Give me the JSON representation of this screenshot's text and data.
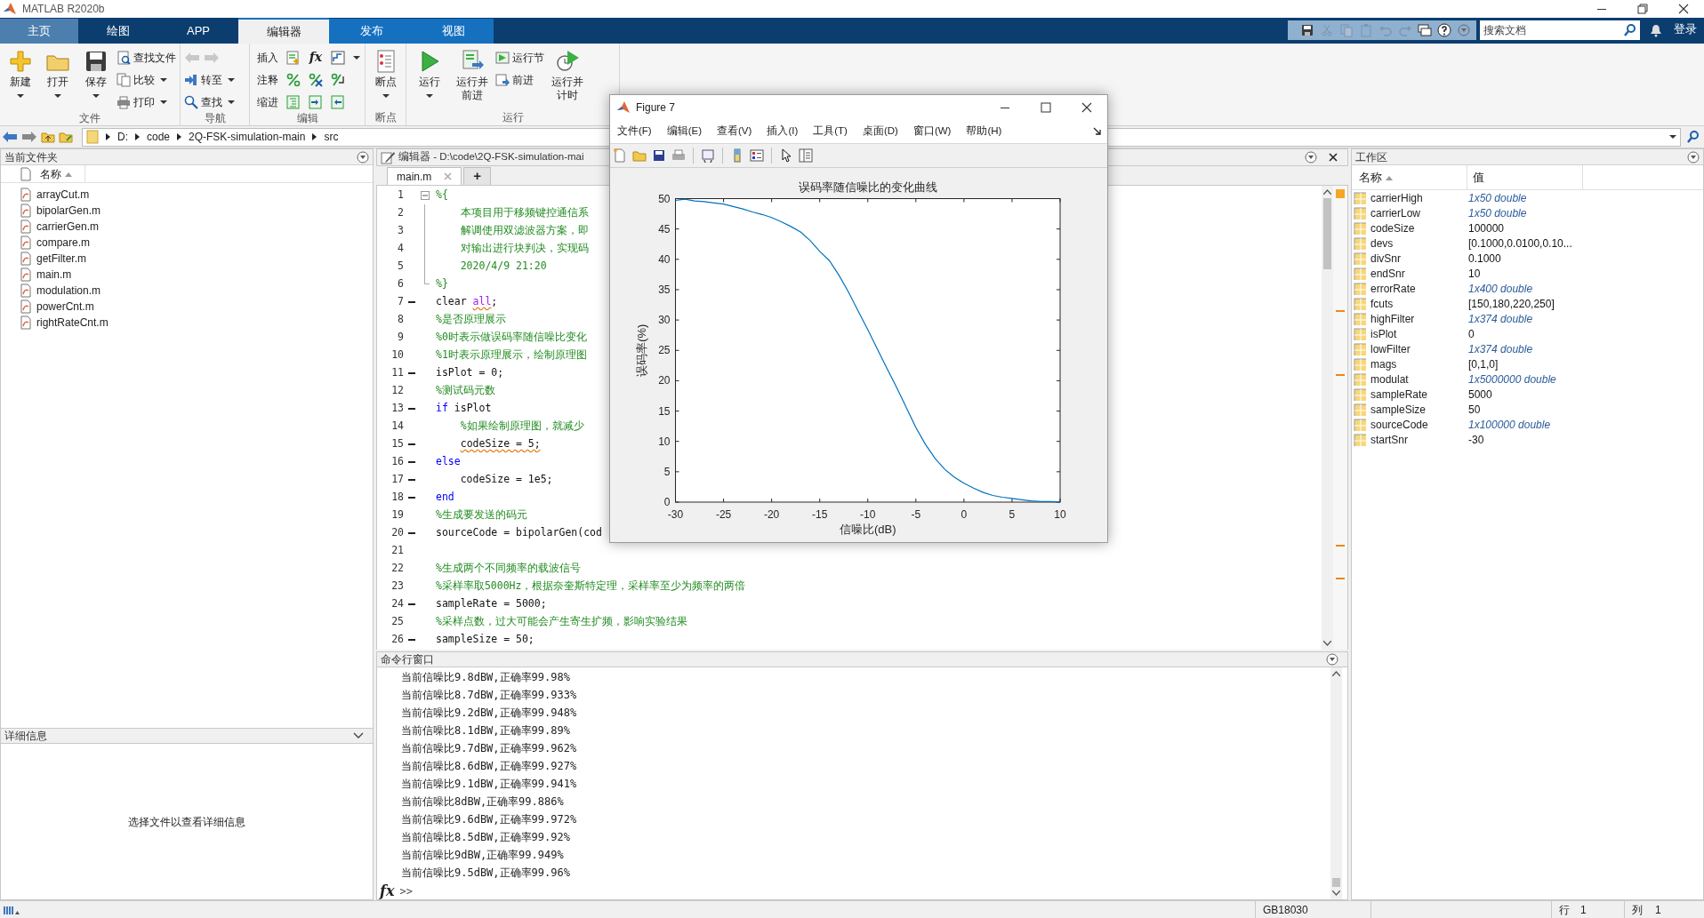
{
  "window": {
    "title": "MATLAB R2020b"
  },
  "ribbon_tabs": [
    {
      "label": "主页",
      "selected": false,
      "highlighted": true,
      "contextual": false
    },
    {
      "label": "绘图",
      "selected": false,
      "highlighted": false,
      "contextual": false
    },
    {
      "label": "APP",
      "selected": false,
      "highlighted": false,
      "contextual": false
    },
    {
      "label": "编辑器",
      "selected": true,
      "highlighted": false,
      "contextual": true
    },
    {
      "label": "发布",
      "selected": false,
      "highlighted": false,
      "contextual": true
    },
    {
      "label": "视图",
      "selected": false,
      "highlighted": false,
      "contextual": true
    }
  ],
  "search": {
    "placeholder": "搜索文档"
  },
  "sign_in": "登录",
  "ribbon_groups": [
    {
      "label": "文件",
      "items": [
        {
          "kind": "large",
          "label": "新建",
          "dropdown": true
        },
        {
          "kind": "large",
          "label": "打开",
          "dropdown": true
        },
        {
          "kind": "large",
          "label": "保存",
          "dropdown": true
        },
        {
          "kind": "small",
          "label": "查找文件",
          "dropdown": false
        },
        {
          "kind": "small",
          "label": "比较",
          "dropdown": true
        },
        {
          "kind": "small",
          "label": "打印",
          "dropdown": true
        }
      ]
    },
    {
      "label": "导航",
      "items": [
        {
          "kind": "history",
          "disabled": true
        },
        {
          "kind": "small",
          "label": "转至",
          "dropdown": true
        },
        {
          "kind": "small",
          "label": "查找",
          "dropdown": true
        }
      ]
    },
    {
      "label": "编辑",
      "items": [
        {
          "kind": "row",
          "label": "插入",
          "glyph": "fx",
          "dropdown": true
        },
        {
          "kind": "row",
          "label": "注释",
          "dropdown": false
        },
        {
          "kind": "row",
          "label": "缩进",
          "dropdown": false
        }
      ]
    },
    {
      "label": "断点",
      "items": [
        {
          "kind": "large",
          "label": "断点",
          "dropdown": true
        }
      ]
    },
    {
      "label": "运行",
      "items": [
        {
          "kind": "large",
          "label": "运行",
          "dropdown": true
        },
        {
          "kind": "large",
          "label": "运行并前进",
          "dropdown": false
        },
        {
          "kind": "small",
          "label": "运行节",
          "dropdown": false
        },
        {
          "kind": "small",
          "label": "前进",
          "dropdown": false
        },
        {
          "kind": "large",
          "label": "运行并计时",
          "dropdown": false
        }
      ]
    }
  ],
  "address_bar": {
    "path": [
      "D:",
      "code",
      "2Q-FSK-simulation-main",
      "src"
    ]
  },
  "current_folder": {
    "title": "当前文件夹",
    "column": "名称",
    "files": [
      "arrayCut.m",
      "bipolarGen.m",
      "carrierGen.m",
      "compare.m",
      "getFilter.m",
      "main.m",
      "modulation.m",
      "powerCnt.m",
      "rightRateCnt.m"
    ]
  },
  "details": {
    "title": "详细信息",
    "message": "选择文件以查看详细信息"
  },
  "editor": {
    "title": "编辑器 - D:\\code\\2Q-FSK-simulation-mai",
    "tabs": [
      {
        "label": "main.m",
        "selected": true
      },
      {
        "label": "+",
        "selected": false
      }
    ],
    "lines": [
      {
        "number": "1",
        "executable": false,
        "fold_start": true,
        "segments": [
          {
            "text": "%{",
            "kind": "comment"
          }
        ]
      },
      {
        "number": "2",
        "executable": false,
        "segments": [
          {
            "text": "    本项目用于移频键控通信系",
            "kind": "comment"
          }
        ]
      },
      {
        "number": "3",
        "executable": false,
        "segments": [
          {
            "text": "    解调使用双滤波器方案，即",
            "kind": "comment"
          }
        ]
      },
      {
        "number": "4",
        "executable": false,
        "segments": [
          {
            "text": "    对输出进行块判决，实现码",
            "kind": "comment"
          }
        ]
      },
      {
        "number": "5",
        "executable": false,
        "segments": [
          {
            "text": "    2020/4/9 21:20",
            "kind": "comment"
          }
        ]
      },
      {
        "number": "6",
        "executable": false,
        "fold_end": true,
        "segments": [
          {
            "text": "%}",
            "kind": "comment"
          }
        ]
      },
      {
        "number": "7",
        "executable": true,
        "segments": [
          {
            "text": "clear ",
            "kind": "code"
          },
          {
            "text": "all",
            "kind": "string",
            "warning": true
          },
          {
            "text": ";",
            "kind": "code"
          }
        ]
      },
      {
        "number": "8",
        "executable": false,
        "segments": [
          {
            "text": "%是否原理展示",
            "kind": "comment"
          }
        ]
      },
      {
        "number": "9",
        "executable": false,
        "segments": [
          {
            "text": "%0时表示做误码率随信噪比变化",
            "kind": "comment"
          }
        ]
      },
      {
        "number": "10",
        "executable": false,
        "segments": [
          {
            "text": "%1时表示原理展示，绘制原理图",
            "kind": "comment"
          }
        ]
      },
      {
        "number": "11",
        "executable": true,
        "segments": [
          {
            "text": "isPlot = 0;",
            "kind": "code"
          }
        ]
      },
      {
        "number": "12",
        "executable": false,
        "segments": [
          {
            "text": "%测试码元数",
            "kind": "comment"
          }
        ]
      },
      {
        "number": "13",
        "executable": true,
        "segments": [
          {
            "text": "if",
            "kind": "keyword"
          },
          {
            "text": " isPlot",
            "kind": "code"
          }
        ]
      },
      {
        "number": "14",
        "executable": false,
        "segments": [
          {
            "text": "    %如果绘制原理图，就减少",
            "kind": "comment"
          }
        ]
      },
      {
        "number": "15",
        "executable": true,
        "segments": [
          {
            "text": "    codeSize = 5;",
            "kind": "code",
            "warning": true
          }
        ]
      },
      {
        "number": "16",
        "executable": true,
        "segments": [
          {
            "text": "else",
            "kind": "keyword"
          }
        ]
      },
      {
        "number": "17",
        "executable": true,
        "segments": [
          {
            "text": "    codeSize = 1e5;",
            "kind": "code"
          }
        ]
      },
      {
        "number": "18",
        "executable": true,
        "segments": [
          {
            "text": "end",
            "kind": "keyword"
          }
        ]
      },
      {
        "number": "19",
        "executable": false,
        "segments": [
          {
            "text": "%生成要发送的码元",
            "kind": "comment"
          }
        ]
      },
      {
        "number": "20",
        "executable": true,
        "segments": [
          {
            "text": "sourceCode = bipolarGen(cod",
            "kind": "code"
          }
        ]
      },
      {
        "number": "21",
        "executable": false
      },
      {
        "number": "22",
        "executable": false,
        "segments": [
          {
            "text": "%生成两个不同频率的载波信号",
            "kind": "comment"
          }
        ]
      },
      {
        "number": "23",
        "executable": false,
        "segments": [
          {
            "text": "%采样率取5000Hz，根据奈奎斯特定理，采样率至少为频率的两倍",
            "kind": "comment"
          }
        ]
      },
      {
        "number": "24",
        "executable": true,
        "segments": [
          {
            "text": "sampleRate = 5000;",
            "kind": "code"
          }
        ]
      },
      {
        "number": "25",
        "executable": false,
        "segments": [
          {
            "text": "%采样点数，过大可能会产生寄生扩频，影响实验结果",
            "kind": "comment"
          }
        ]
      },
      {
        "number": "26",
        "executable": true,
        "segments": [
          {
            "text": "sampleSize = 50;",
            "kind": "code"
          }
        ]
      }
    ]
  },
  "command_window": {
    "title": "命令行窗口",
    "lines": [
      "当前信噪比9.8dBW,正确率99.98%",
      "当前信噪比8.7dBW,正确率99.933%",
      "当前信噪比9.2dBW,正确率99.948%",
      "当前信噪比8.1dBW,正确率99.89%",
      "当前信噪比9.7dBW,正确率99.962%",
      "当前信噪比8.6dBW,正确率99.927%",
      "当前信噪比9.1dBW,正确率99.941%",
      "当前信噪比8dBW,正确率99.886%",
      "当前信噪比9.6dBW,正确率99.972%",
      "当前信噪比8.5dBW,正确率99.92%",
      "当前信噪比9dBW,正确率99.949%",
      "当前信噪比9.5dBW,正确率99.96%"
    ],
    "prompt_icon": "fx",
    "prompt": ">>"
  },
  "workspace": {
    "title": "工作区",
    "columns": [
      "名称",
      "值"
    ],
    "variables": [
      {
        "name": "carrierHigh",
        "value": "1x50 double",
        "kind": "summary"
      },
      {
        "name": "carrierLow",
        "value": "1x50 double",
        "kind": "summary"
      },
      {
        "name": "codeSize",
        "value": "100000",
        "kind": "value"
      },
      {
        "name": "devs",
        "value": "[0.1000,0.0100,0.10...",
        "kind": "value"
      },
      {
        "name": "divSnr",
        "value": "0.1000",
        "kind": "value"
      },
      {
        "name": "endSnr",
        "value": "10",
        "kind": "value"
      },
      {
        "name": "errorRate",
        "value": "1x400 double",
        "kind": "summary"
      },
      {
        "name": "fcuts",
        "value": "[150,180,220,250]",
        "kind": "value"
      },
      {
        "name": "highFilter",
        "value": "1x374 double",
        "kind": "summary"
      },
      {
        "name": "isPlot",
        "value": "0",
        "kind": "value"
      },
      {
        "name": "lowFilter",
        "value": "1x374 double",
        "kind": "summary"
      },
      {
        "name": "mags",
        "value": "[0,1,0]",
        "kind": "value"
      },
      {
        "name": "modulat",
        "value": "1x5000000 double",
        "kind": "summary"
      },
      {
        "name": "sampleRate",
        "value": "5000",
        "kind": "value"
      },
      {
        "name": "sampleSize",
        "value": "50",
        "kind": "value"
      },
      {
        "name": "sourceCode",
        "value": "1x100000 double",
        "kind": "summary"
      },
      {
        "name": "startSnr",
        "value": "-30",
        "kind": "value"
      }
    ]
  },
  "status_bar": {
    "encoding": "GB18030",
    "line_label": "行",
    "line": "1",
    "column_label": "列",
    "column": "1"
  },
  "figure": {
    "title": "Figure 7",
    "menu": [
      "文件(F)",
      "编辑(E)",
      "查看(V)",
      "插入(I)",
      "工具(T)",
      "桌面(D)",
      "窗口(W)",
      "帮助(H)"
    ],
    "chart_data": {
      "type": "line",
      "title": "误码率随信噪比的变化曲线",
      "xlabel": "信噪比(dB)",
      "ylabel": "误码率(%)",
      "x": [
        -30,
        -29,
        -28,
        -27,
        -26,
        -25,
        -24,
        -23,
        -22,
        -21,
        -20,
        -19,
        -18,
        -17,
        -16,
        -15,
        -14,
        -13,
        -12,
        -11,
        -10,
        -9,
        -8,
        -7,
        -6,
        -5,
        -4,
        -3,
        -2,
        -1,
        0,
        1,
        2,
        3,
        4,
        5,
        6,
        7,
        8,
        9,
        10
      ],
      "series": [
        {
          "color": "#0072bd",
          "values": [
            49.7,
            49.9,
            49.6,
            49.5,
            49.3,
            49.1,
            48.7,
            48.3,
            47.8,
            47.4,
            46.9,
            46.2,
            45.4,
            44.5,
            43.1,
            41.3,
            39.8,
            37.4,
            34.6,
            31.5,
            28.4,
            25.2,
            22.0,
            18.9,
            15.6,
            12.3,
            9.5,
            7.2,
            5.4,
            4.1,
            3.1,
            2.3,
            1.6,
            1.1,
            0.8,
            0.6,
            0.4,
            0.2,
            0.1,
            0.1,
            0.0
          ]
        }
      ],
      "xlim": [
        -30,
        10
      ],
      "ylim": [
        0,
        50
      ],
      "xticks": [
        -30,
        -25,
        -20,
        -15,
        -10,
        -5,
        0,
        5,
        10
      ],
      "yticks": [
        0,
        5,
        10,
        15,
        20,
        25,
        30,
        35,
        40,
        45,
        50
      ]
    }
  }
}
